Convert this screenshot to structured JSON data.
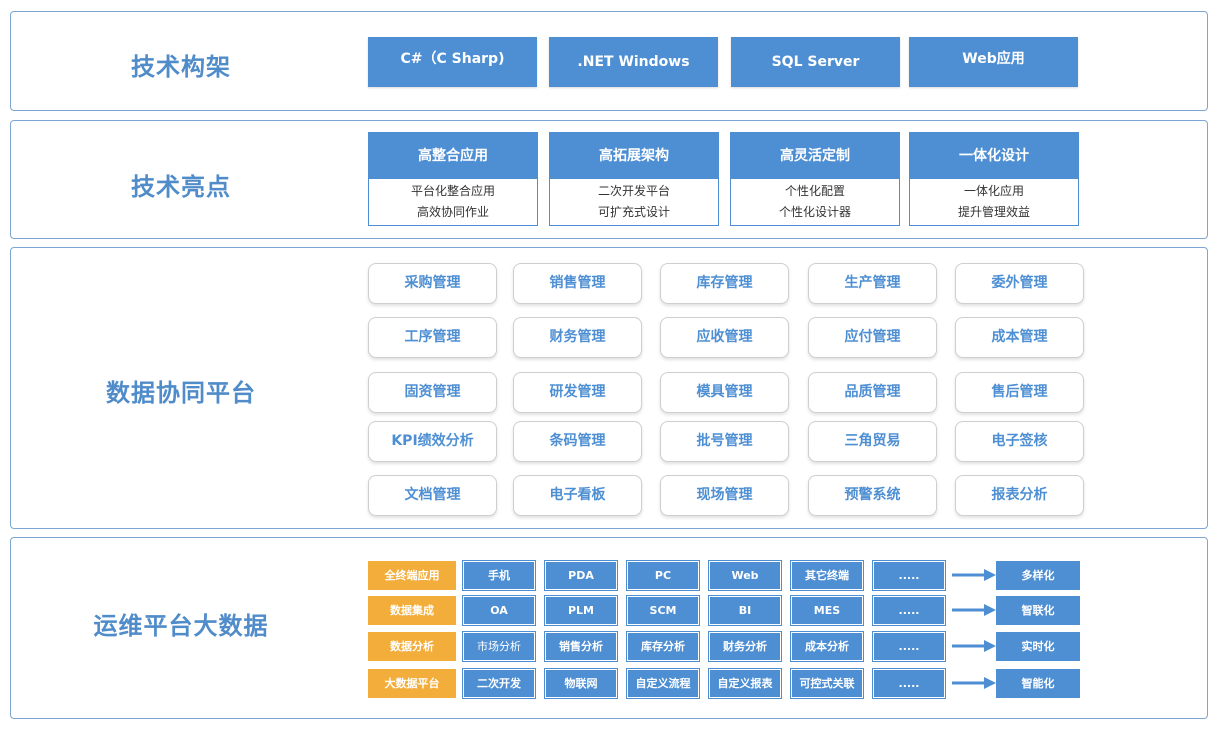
{
  "sections": {
    "tech_stack": {
      "title": "技术构架",
      "items": [
        "C#（C Sharp)",
        ".NET Windows",
        "SQL Server",
        "Web应用"
      ]
    },
    "highlights": {
      "title": "技术亮点",
      "items": [
        {
          "head": "高整合应用",
          "lines": [
            "平台化整合应用",
            "高效协同作业"
          ]
        },
        {
          "head": "高拓展架构",
          "lines": [
            "二次开发平台",
            "可扩充式设计"
          ]
        },
        {
          "head": "高灵活定制",
          "lines": [
            "个性化配置",
            "个性化设计器"
          ]
        },
        {
          "head": "一体化设计",
          "lines": [
            "一体化应用",
            "提升管理效益"
          ]
        }
      ]
    },
    "data_platform": {
      "title": "数据协同平台",
      "modules": [
        [
          "采购管理",
          "销售管理",
          "库存管理",
          "生产管理",
          "委外管理"
        ],
        [
          "工序管理",
          "财务管理",
          "应收管理",
          "应付管理",
          "成本管理"
        ],
        [
          "固资管理",
          "研发管理",
          "模具管理",
          "品质管理",
          "售后管理"
        ],
        [
          "KPI绩效分析",
          "条码管理",
          "批号管理",
          "三角贸易",
          "电子签核"
        ],
        [
          "文档管理",
          "电子看板",
          "现场管理",
          "预警系统",
          "报表分析"
        ]
      ]
    },
    "ops_platform": {
      "title": "运维平台大数据",
      "rows": [
        {
          "label": "全终端应用",
          "cells": [
            "手机",
            "PDA",
            "PC",
            "Web",
            "其它终端",
            "....."
          ],
          "result": "多样化"
        },
        {
          "label": "数据集成",
          "cells": [
            "OA",
            "PLM",
            "SCM",
            "BI",
            "MES",
            "....."
          ],
          "result": "智联化"
        },
        {
          "label": "数据分析",
          "cells": [
            "市场分析",
            "销售分析",
            "库存分析",
            "财务分析",
            "成本分析",
            "....."
          ],
          "result": "实时化"
        },
        {
          "label": "大数据平台",
          "cells": [
            "二次开发",
            "物联网",
            "自定义流程",
            "自定义报表",
            "可控式关联",
            "....."
          ],
          "result": "智能化"
        }
      ]
    }
  },
  "colors": {
    "primary": "#4e8fd3",
    "accent": "#f2ad3a",
    "border": "#7da7d1"
  }
}
